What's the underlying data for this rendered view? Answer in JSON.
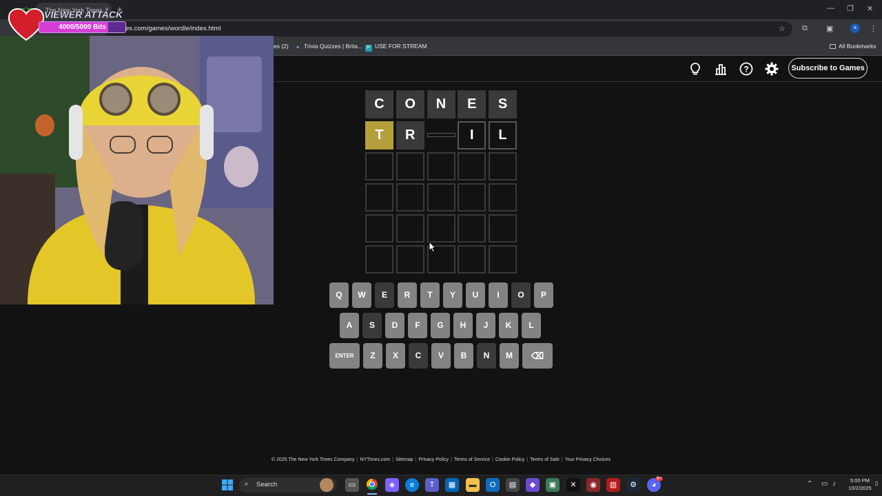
{
  "browser": {
    "tab_title": "The New York Times",
    "tab_close": "×",
    "new_tab": "+",
    "url": "es.com/games/wordle/index.html",
    "window_controls": [
      "—",
      "❐",
      "✕"
    ],
    "bookmarks": [
      {
        "label": "es (2)"
      },
      {
        "label": "Trivia Quizzes | Brita..."
      },
      {
        "label": "USE FOR STREAM",
        "icon_letter": "P"
      }
    ],
    "all_bookmarks": "All Bookmarks",
    "profile_initial": "a"
  },
  "overlay": {
    "title": "VIEWER ATTACK",
    "progress_text": "4000/5000 Bits",
    "progress_fraction": 0.8,
    "colors": {
      "heart": "#d21f2b",
      "bar": "#5e2a92",
      "fill": "#d63ed5"
    }
  },
  "header": {
    "subscribe_label": "Subscribe to Games",
    "icons": [
      "lightbulb-icon",
      "stats-icon",
      "help-icon",
      "settings-icon"
    ]
  },
  "board": {
    "rows": [
      [
        {
          "letter": "C",
          "state": "absent"
        },
        {
          "letter": "O",
          "state": "absent"
        },
        {
          "letter": "N",
          "state": "absent"
        },
        {
          "letter": "E",
          "state": "absent"
        },
        {
          "letter": "S",
          "state": "absent"
        }
      ],
      [
        {
          "letter": "T",
          "state": "present"
        },
        {
          "letter": "R",
          "state": "absent"
        },
        {
          "letter": "",
          "state": "revealing"
        },
        {
          "letter": "I",
          "state": "tbd"
        },
        {
          "letter": "L",
          "state": "tbd"
        }
      ],
      [
        {
          "letter": "",
          "state": "empty"
        },
        {
          "letter": "",
          "state": "empty"
        },
        {
          "letter": "",
          "state": "empty"
        },
        {
          "letter": "",
          "state": "empty"
        },
        {
          "letter": "",
          "state": "empty"
        }
      ],
      [
        {
          "letter": "",
          "state": "empty"
        },
        {
          "letter": "",
          "state": "empty"
        },
        {
          "letter": "",
          "state": "empty"
        },
        {
          "letter": "",
          "state": "empty"
        },
        {
          "letter": "",
          "state": "empty"
        }
      ],
      [
        {
          "letter": "",
          "state": "empty"
        },
        {
          "letter": "",
          "state": "empty"
        },
        {
          "letter": "",
          "state": "empty"
        },
        {
          "letter": "",
          "state": "empty"
        },
        {
          "letter": "",
          "state": "empty"
        }
      ],
      [
        {
          "letter": "",
          "state": "empty"
        },
        {
          "letter": "",
          "state": "empty"
        },
        {
          "letter": "",
          "state": "empty"
        },
        {
          "letter": "",
          "state": "empty"
        },
        {
          "letter": "",
          "state": "empty"
        }
      ]
    ],
    "colors": {
      "absent": "#3a3a3c",
      "present": "#b59f3b",
      "unused": "#818384"
    }
  },
  "keyboard": {
    "rows": [
      [
        {
          "label": "Q",
          "state": "unused"
        },
        {
          "label": "W",
          "state": "unused"
        },
        {
          "label": "E",
          "state": "absent"
        },
        {
          "label": "R",
          "state": "unused"
        },
        {
          "label": "T",
          "state": "unused"
        },
        {
          "label": "Y",
          "state": "unused"
        },
        {
          "label": "U",
          "state": "unused"
        },
        {
          "label": "I",
          "state": "unused"
        },
        {
          "label": "O",
          "state": "absent"
        },
        {
          "label": "P",
          "state": "unused"
        }
      ],
      [
        {
          "label": "A",
          "state": "unused"
        },
        {
          "label": "S",
          "state": "absent"
        },
        {
          "label": "D",
          "state": "unused"
        },
        {
          "label": "F",
          "state": "unused"
        },
        {
          "label": "G",
          "state": "unused"
        },
        {
          "label": "H",
          "state": "unused"
        },
        {
          "label": "J",
          "state": "unused"
        },
        {
          "label": "K",
          "state": "unused"
        },
        {
          "label": "L",
          "state": "unused"
        }
      ],
      [
        {
          "label": "ENTER",
          "state": "unused"
        },
        {
          "label": "Z",
          "state": "unused"
        },
        {
          "label": "X",
          "state": "unused"
        },
        {
          "label": "C",
          "state": "absent"
        },
        {
          "label": "V",
          "state": "unused"
        },
        {
          "label": "B",
          "state": "unused"
        },
        {
          "label": "N",
          "state": "absent"
        },
        {
          "label": "M",
          "state": "unused"
        },
        {
          "label": "⌫",
          "state": "unused",
          "icon": "backspace-icon"
        }
      ]
    ]
  },
  "footer": {
    "links": [
      "© 2025 The New York Times Company",
      "NYTimes.com",
      "Sitemap",
      "Privacy Policy",
      "Terms of Service",
      "Cookie Policy",
      "Terms of Sale",
      "Your Privacy Choices"
    ]
  },
  "taskbar": {
    "search_label": "Search",
    "time": "5:00 PM",
    "date": "10/2/2025",
    "discord_badge": "9+"
  }
}
